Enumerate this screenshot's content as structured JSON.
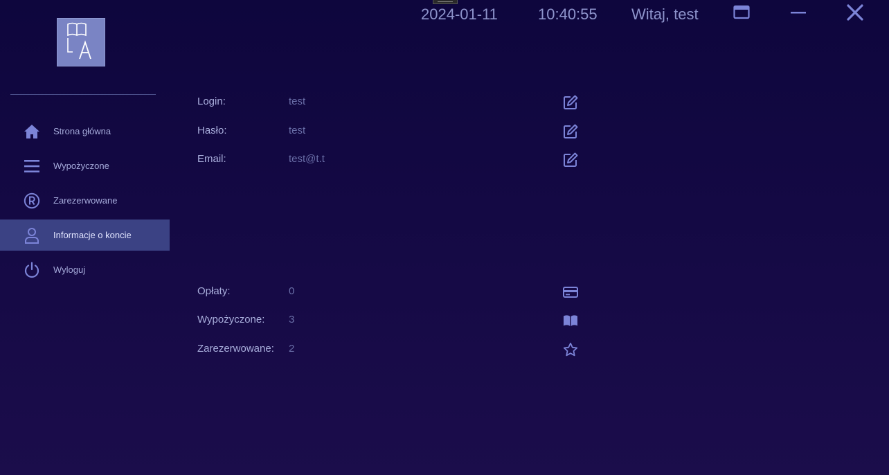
{
  "app": {
    "logo_text": "LA"
  },
  "header": {
    "date": "2024-01-11",
    "time": "10:40:55",
    "greeting": "Witaj, test"
  },
  "sidebar": {
    "items": [
      {
        "label": "Strona główna",
        "icon": "home-icon",
        "active": false
      },
      {
        "label": "Wypożyczone",
        "icon": "menu-icon",
        "active": false
      },
      {
        "label": "Zarezerwowane",
        "icon": "registered-icon",
        "active": false
      },
      {
        "label": "Informacje o koncie",
        "icon": "user-icon",
        "active": true
      },
      {
        "label": "Wyloguj",
        "icon": "power-icon",
        "active": false
      }
    ]
  },
  "account": {
    "fields": [
      {
        "label": "Login:",
        "value": "test",
        "icon": "edit-icon"
      },
      {
        "label": "Hasło:",
        "value": "test",
        "icon": "edit-icon"
      },
      {
        "label": "Email:",
        "value": "test@t.t",
        "icon": "edit-icon"
      }
    ],
    "stats": [
      {
        "label": "Opłaty:",
        "value": "0",
        "icon": "credit-card-icon"
      },
      {
        "label": "Wypożyczone:",
        "value": "3",
        "icon": "book-icon"
      },
      {
        "label": "Zarezerwowane:",
        "value": "2",
        "icon": "star-icon"
      }
    ]
  },
  "colors": {
    "background_top": "#0e063d",
    "background_bottom": "#1b0d4b",
    "active_item": "#3b4284",
    "icon": "#7c84d8",
    "logo": "#7a84c4"
  }
}
